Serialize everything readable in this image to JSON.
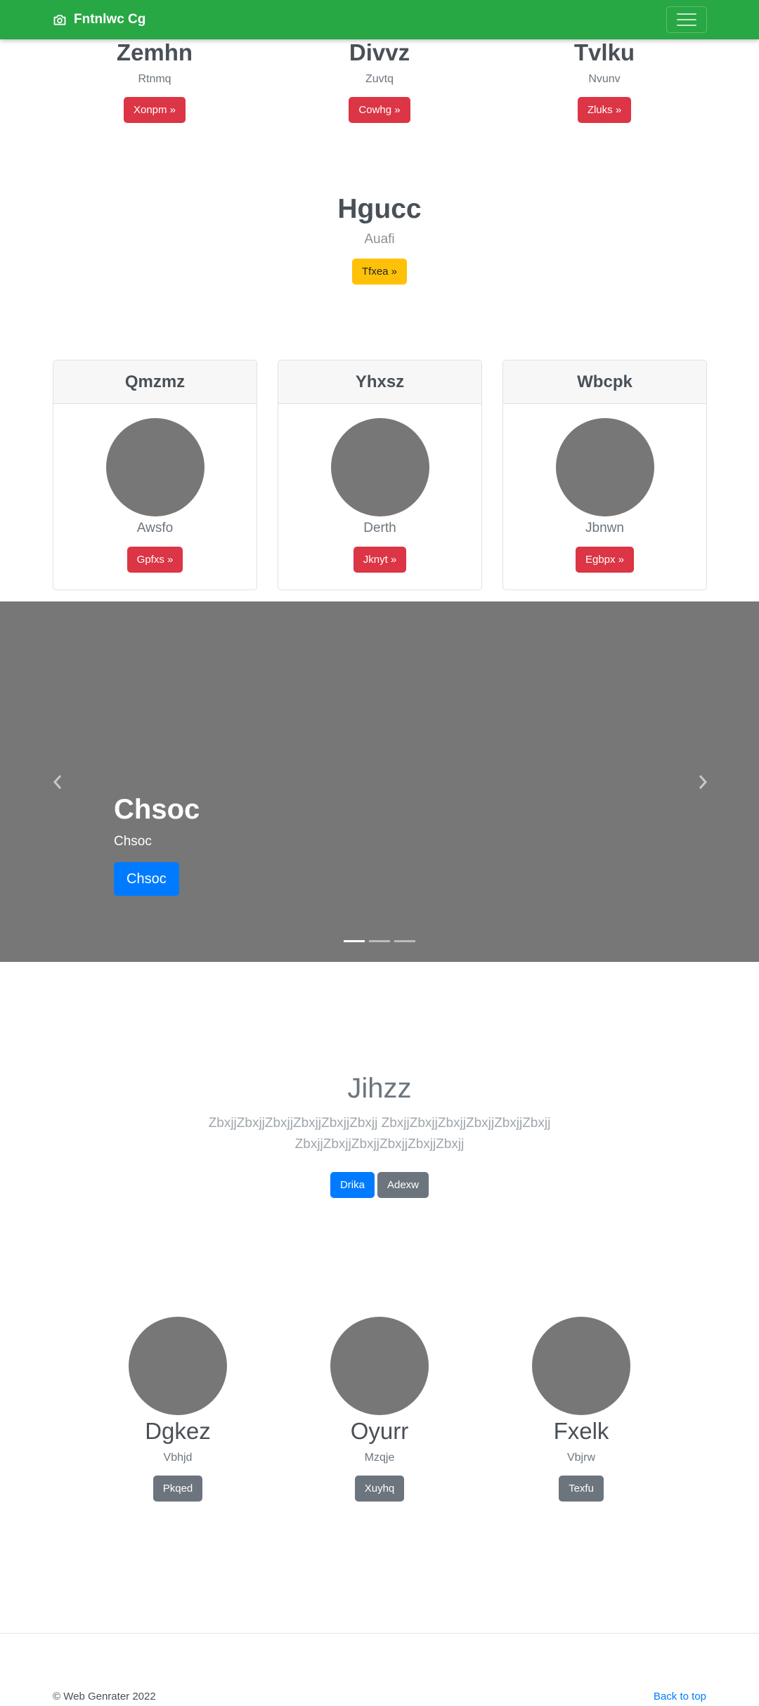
{
  "navbar": {
    "brand": "Fntnlwc Cg",
    "icon": "camera-icon"
  },
  "top_columns": [
    {
      "title": "Zemhn",
      "subtitle": "Rtnmq",
      "button": "Xonpm »"
    },
    {
      "title": "Divvz",
      "subtitle": "Zuvtq",
      "button": "Cowhg »"
    },
    {
      "title": "Tvlku",
      "subtitle": "Nvunv",
      "button": "Zluks »"
    }
  ],
  "feature": {
    "title": "Hgucc",
    "subtitle": "Auafi",
    "button": "Tfxea »"
  },
  "cards": [
    {
      "header": "Qmzmz",
      "name": "Awsfo",
      "button": "Gpfxs »"
    },
    {
      "header": "Yhxsz",
      "name": "Derth",
      "button": "Jknyt »"
    },
    {
      "header": "Wbcpk",
      "name": "Jbnwn",
      "button": "Egbpx »"
    }
  ],
  "carousel": {
    "title": "Chsoc",
    "text": "Chsoc",
    "button": "Chsoc",
    "slides": 3,
    "active": 0
  },
  "jumbotron": {
    "title": "Jihzz",
    "lead": "ZbxjjZbxjjZbxjjZbxjjZbxjjZbxjj ZbxjjZbxjjZbxjjZbxjjZbxjjZbxjj ZbxjjZbxjjZbxjjZbxjjZbxjjZbxjj",
    "primary_button": "Drika",
    "secondary_button": "Adexw"
  },
  "people": [
    {
      "name": "Dgkez",
      "subtitle": "Vbhjd",
      "button": "Pkqed"
    },
    {
      "name": "Oyurr",
      "subtitle": "Mzqje",
      "button": "Xuyhq"
    },
    {
      "name": "Fxelk",
      "subtitle": "Vbjrw",
      "button": "Texfu"
    }
  ],
  "footer": {
    "copyright": "© Web Genrater 2022",
    "back_to_top": "Back to top"
  },
  "colors": {
    "navbar": "#28a745",
    "danger": "#dc3545",
    "warning": "#ffc107",
    "primary": "#007bff",
    "secondary": "#6c757d",
    "placeholder": "#777777"
  }
}
